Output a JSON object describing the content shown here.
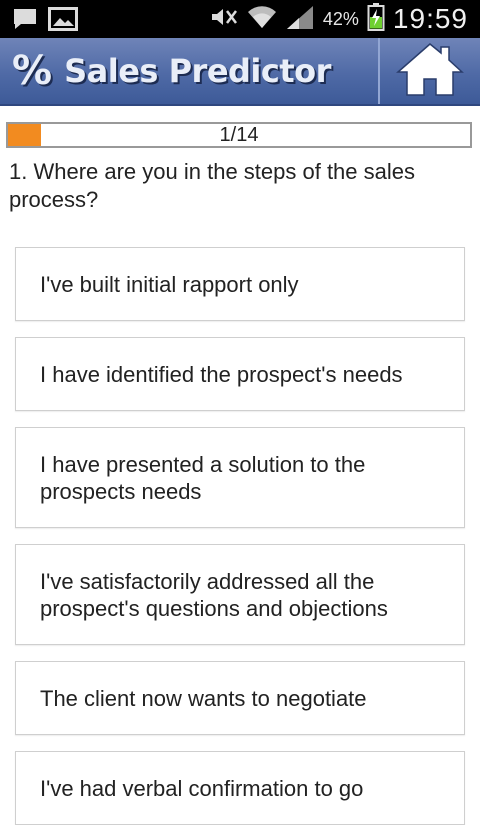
{
  "status_bar": {
    "battery_percent": "42%",
    "time": "19:59",
    "icons": [
      "message-icon",
      "image-icon",
      "mute-icon",
      "wifi-icon",
      "signal-icon",
      "battery-icon"
    ]
  },
  "app": {
    "logo_text": "%",
    "title": "Sales Predictor",
    "brand_color": "#4f6aa6",
    "home_icon": "home-icon"
  },
  "progress": {
    "label": "1/14",
    "current": 1,
    "total": 14,
    "fraction": 0.071,
    "fill_color": "#f28b20"
  },
  "question": {
    "text": "1. Where are you in the steps of the sales process?"
  },
  "options": [
    {
      "label": "I've built initial rapport only"
    },
    {
      "label": "I have identified the prospect's needs"
    },
    {
      "label": "I have presented a solution to the prospects needs"
    },
    {
      "label": "I've satisfactorily addressed all the prospect's questions and objections"
    },
    {
      "label": "The client now wants to negotiate"
    },
    {
      "label": "I've had verbal confirmation to go"
    }
  ]
}
